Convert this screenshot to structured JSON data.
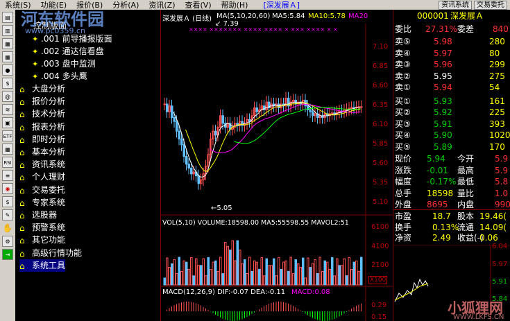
{
  "menu": {
    "items": [
      "系统(S)",
      "功能(E)",
      "报价(B)",
      "分析(A)",
      "资讯(Z)",
      "查看(V)",
      "帮助(H)"
    ],
    "title": "[深发展Ａ]",
    "btn_trade_sys": "资讯系统",
    "btn_trade": "交易委托"
  },
  "watermark": {
    "text": "河东软件园",
    "sub": "www.pc0359.cn"
  },
  "sidebar": {
    "header": "控制版面",
    "sub_items": [
      ".001 前导播报版面",
      ".002 通达信看盘",
      ".003 盘中监测",
      ".004 多头鹰"
    ],
    "items": [
      "大盘分析",
      "报价分析",
      "技术分析",
      "报表分析",
      "即时分析",
      "基本分析",
      "资讯系统",
      "个人理财",
      "交易委托",
      "专家系统",
      "选股器",
      "预警系统",
      "其它功能",
      "高级行情功能",
      "系统工具"
    ]
  },
  "toolbar": {
    "etf": "ETF",
    "rsi": "RSI"
  },
  "chart": {
    "title": "深发展Ａ (日线)",
    "ma_label": "MA(5,10,20,60)",
    "ma5": "MA5:5.84",
    "ma10": "MA10:5.78",
    "ma20": "MA20",
    "high_label": "7.39",
    "low_label": "5.05",
    "price_ticks": [
      "7.10",
      "6.85",
      "6.60",
      "6.35",
      "6.10",
      "5.85",
      "5.60",
      "5.35",
      "5.10"
    ],
    "vol_header": "VOL(5,10) VOLUME:18598.00  MA5:55598.55  MAVOL2:51",
    "vol_ticks": [
      "6100",
      "4100",
      "2100"
    ],
    "vol_unit": "X100",
    "macd_header_a": "MACD(12,26,9)  DIF:-0.07  DEA:-0.11",
    "macd_header_b": "MACD:0.08",
    "macd_ticks": [
      "0.29",
      "0.15"
    ]
  },
  "quote": {
    "code": "000001",
    "name": "深发展Ａ",
    "weibi_label": "委比",
    "weibi": "27.31%",
    "weicha_label": "委差",
    "weicha": "840",
    "sells": [
      {
        "label": "卖⑤",
        "price": "5.98",
        "vol": "280"
      },
      {
        "label": "卖④",
        "price": "5.97",
        "vol": "80"
      },
      {
        "label": "卖③",
        "price": "5.96",
        "vol": "299"
      },
      {
        "label": "卖②",
        "price": "5.95",
        "vol": "275"
      },
      {
        "label": "卖①",
        "price": "5.94",
        "vol": "54"
      }
    ],
    "buys": [
      {
        "label": "买①",
        "price": "5.93",
        "vol": "161"
      },
      {
        "label": "买②",
        "price": "5.92",
        "vol": "225"
      },
      {
        "label": "买③",
        "price": "5.91",
        "vol": "393"
      },
      {
        "label": "买④",
        "price": "5.90",
        "vol": "1020"
      },
      {
        "label": "买⑤",
        "price": "5.89",
        "vol": "170"
      }
    ],
    "stats": [
      {
        "l1": "现价",
        "v1": "5.94",
        "l2": "今开",
        "v2": "5.9"
      },
      {
        "l1": "涨跌",
        "v1": "-0.01",
        "l2": "最高",
        "v2": "5.9"
      },
      {
        "l1": "幅度",
        "v1": "-0.17%",
        "l2": "最低",
        "v2": "5.8"
      },
      {
        "l1": "总手",
        "v1": "18598",
        "l2": "量比",
        "v2": "1.0"
      },
      {
        "l1": "外盘",
        "v1": "8695",
        "l2": "内盘",
        "v2": "990"
      }
    ],
    "stats2": [
      {
        "l1": "市盈",
        "v1": "18.7",
        "l2": "股本",
        "v2": "19.46("
      },
      {
        "l1": "换手",
        "v1": "0.13%",
        "l2": "流通",
        "v2": "14.09("
      },
      {
        "l1": "净资",
        "v1": "2.49",
        "l2": "收益(-)",
        "v2": "0.06"
      }
    ],
    "mini_ticks": [
      "6.04",
      "5.97",
      "5.91",
      "5.84"
    ]
  },
  "watermark_br": {
    "text": "小狐狸网",
    "sub": "WWW.LKFS.CN"
  }
}
